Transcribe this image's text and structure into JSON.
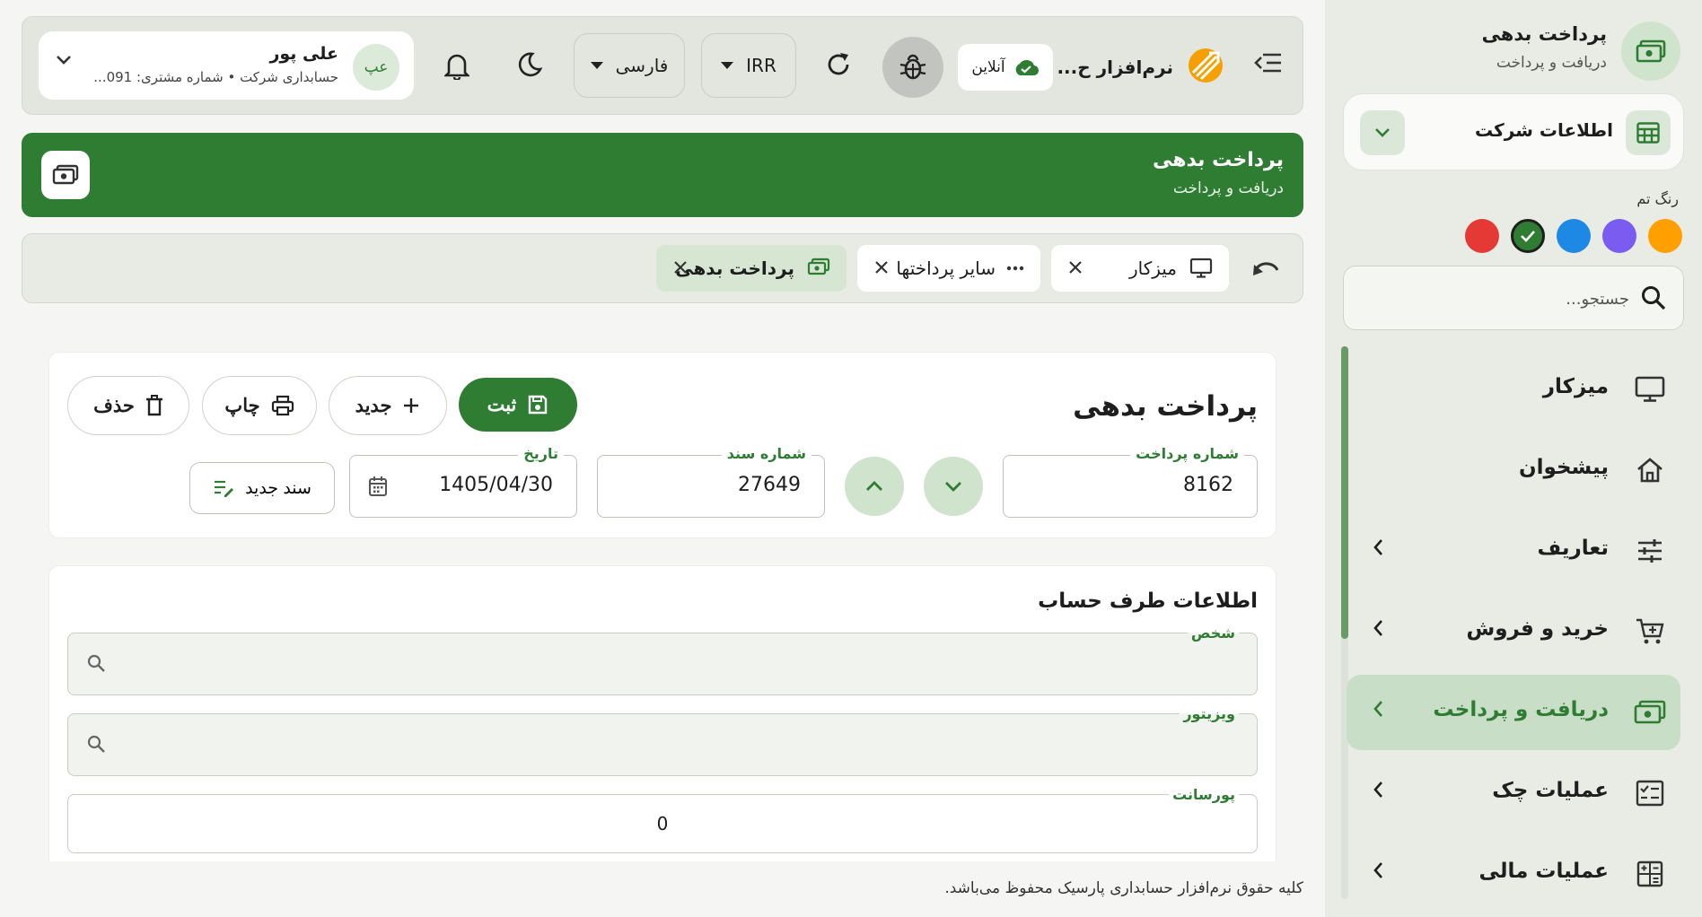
{
  "sidebar": {
    "header": {
      "title": "پرداخت بدهی",
      "subtitle": "دریافت و پرداخت"
    },
    "company": {
      "label": "اطلاعات شرکت"
    },
    "theme": {
      "label": "رنگ تم",
      "colors": [
        "#ffa000",
        "#7a5cf0",
        "#1e88e5",
        "#2e7d32",
        "#e53935"
      ],
      "selected": "#2e7d32"
    },
    "search": {
      "placeholder": "جستجو..."
    },
    "items": [
      {
        "label": "میزکار",
        "icon": "monitor-icon"
      },
      {
        "label": "پیشخوان",
        "icon": "home-icon"
      },
      {
        "label": "تعاریف",
        "icon": "tune-icon"
      },
      {
        "label": "خرید و فروش",
        "icon": "cart-icon"
      },
      {
        "label": "دریافت و پرداخت",
        "icon": "cash-icon"
      },
      {
        "label": "عملیات چک",
        "icon": "checklist-icon"
      },
      {
        "label": "عملیات مالی",
        "icon": "calculator-icon"
      }
    ]
  },
  "topbar": {
    "app_name": "نرم‌افزار ح...",
    "status": "آنلاین",
    "currency": "IRR",
    "language": "فارسی",
    "user": {
      "initials": "عپ",
      "name": "علی پور",
      "subtitle": "حسابداری شرکت • شماره مشتری: 091..."
    }
  },
  "banner": {
    "title": "پرداخت بدهی",
    "subtitle": "دریافت و پرداخت"
  },
  "tabs": [
    {
      "label": "میزکار",
      "icon": "monitor-icon"
    },
    {
      "label": "سایر پرداختها",
      "icon": "dots-icon"
    },
    {
      "label": "پرداخت بدهی",
      "icon": "cash-icon"
    }
  ],
  "form": {
    "title": "پرداخت بدهی",
    "buttons": {
      "save": "ثبت",
      "new": "جدید",
      "print": "چاپ",
      "delete": "حذف",
      "new_doc": "سند جدید"
    },
    "payment_number": {
      "label": "شماره پرداخت",
      "value": "8162"
    },
    "document_number": {
      "label": "شماره سند",
      "value": "27649"
    },
    "date": {
      "label": "تاریخ",
      "value": "1405/04/30"
    }
  },
  "account_section": {
    "title": "اطلاعات طرف حساب",
    "person_label": "شخص",
    "visitor_label": "ویزیتور",
    "commission_label": "پورسانت",
    "commission_value": "0"
  },
  "footer": {
    "text": "کلیه حقوق نرم‌افزار حسابداری پارسیک محفوظ می‌باشد."
  },
  "colors": {
    "primary": "#2e7d32",
    "primary_light": "#cfe3cd",
    "sidebar_bg": "#e8ece4"
  }
}
